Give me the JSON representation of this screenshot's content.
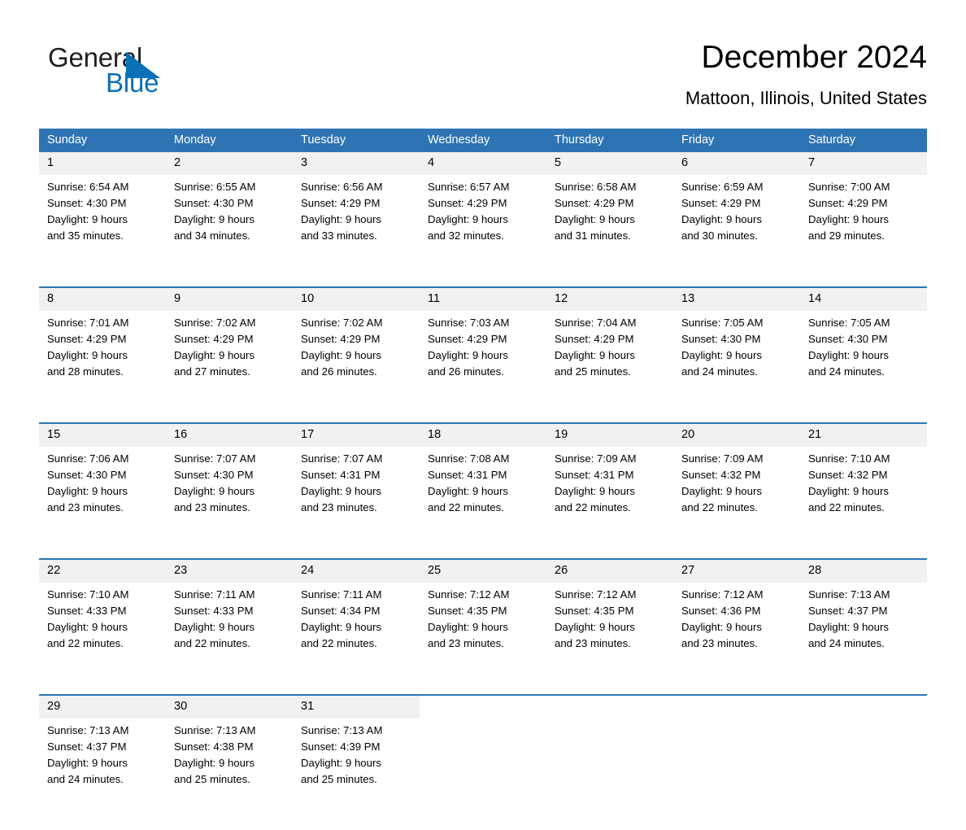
{
  "brand": {
    "word_one": "General",
    "word_two": "Blue",
    "triangle_icon": "brand-triangle-icon",
    "accent_color": "#0a70b8"
  },
  "header": {
    "title": "December 2024",
    "subtitle": "Mattoon, Illinois, United States"
  },
  "theme": {
    "header_band": "#2e74b5",
    "daynum_band": "#f1f1f1",
    "row_rule": "#2e74b5",
    "text": "#000000"
  },
  "calendar": {
    "weekday_headers": [
      "Sunday",
      "Monday",
      "Tuesday",
      "Wednesday",
      "Thursday",
      "Friday",
      "Saturday"
    ],
    "weeks": [
      [
        {
          "day": "1",
          "sunrise": "Sunrise: 6:54 AM",
          "sunset": "Sunset: 4:30 PM",
          "daylight_1": "Daylight: 9 hours",
          "daylight_2": "and 35 minutes."
        },
        {
          "day": "2",
          "sunrise": "Sunrise: 6:55 AM",
          "sunset": "Sunset: 4:30 PM",
          "daylight_1": "Daylight: 9 hours",
          "daylight_2": "and 34 minutes."
        },
        {
          "day": "3",
          "sunrise": "Sunrise: 6:56 AM",
          "sunset": "Sunset: 4:29 PM",
          "daylight_1": "Daylight: 9 hours",
          "daylight_2": "and 33 minutes."
        },
        {
          "day": "4",
          "sunrise": "Sunrise: 6:57 AM",
          "sunset": "Sunset: 4:29 PM",
          "daylight_1": "Daylight: 9 hours",
          "daylight_2": "and 32 minutes."
        },
        {
          "day": "5",
          "sunrise": "Sunrise: 6:58 AM",
          "sunset": "Sunset: 4:29 PM",
          "daylight_1": "Daylight: 9 hours",
          "daylight_2": "and 31 minutes."
        },
        {
          "day": "6",
          "sunrise": "Sunrise: 6:59 AM",
          "sunset": "Sunset: 4:29 PM",
          "daylight_1": "Daylight: 9 hours",
          "daylight_2": "and 30 minutes."
        },
        {
          "day": "7",
          "sunrise": "Sunrise: 7:00 AM",
          "sunset": "Sunset: 4:29 PM",
          "daylight_1": "Daylight: 9 hours",
          "daylight_2": "and 29 minutes."
        }
      ],
      [
        {
          "day": "8",
          "sunrise": "Sunrise: 7:01 AM",
          "sunset": "Sunset: 4:29 PM",
          "daylight_1": "Daylight: 9 hours",
          "daylight_2": "and 28 minutes."
        },
        {
          "day": "9",
          "sunrise": "Sunrise: 7:02 AM",
          "sunset": "Sunset: 4:29 PM",
          "daylight_1": "Daylight: 9 hours",
          "daylight_2": "and 27 minutes."
        },
        {
          "day": "10",
          "sunrise": "Sunrise: 7:02 AM",
          "sunset": "Sunset: 4:29 PM",
          "daylight_1": "Daylight: 9 hours",
          "daylight_2": "and 26 minutes."
        },
        {
          "day": "11",
          "sunrise": "Sunrise: 7:03 AM",
          "sunset": "Sunset: 4:29 PM",
          "daylight_1": "Daylight: 9 hours",
          "daylight_2": "and 26 minutes."
        },
        {
          "day": "12",
          "sunrise": "Sunrise: 7:04 AM",
          "sunset": "Sunset: 4:29 PM",
          "daylight_1": "Daylight: 9 hours",
          "daylight_2": "and 25 minutes."
        },
        {
          "day": "13",
          "sunrise": "Sunrise: 7:05 AM",
          "sunset": "Sunset: 4:30 PM",
          "daylight_1": "Daylight: 9 hours",
          "daylight_2": "and 24 minutes."
        },
        {
          "day": "14",
          "sunrise": "Sunrise: 7:05 AM",
          "sunset": "Sunset: 4:30 PM",
          "daylight_1": "Daylight: 9 hours",
          "daylight_2": "and 24 minutes."
        }
      ],
      [
        {
          "day": "15",
          "sunrise": "Sunrise: 7:06 AM",
          "sunset": "Sunset: 4:30 PM",
          "daylight_1": "Daylight: 9 hours",
          "daylight_2": "and 23 minutes."
        },
        {
          "day": "16",
          "sunrise": "Sunrise: 7:07 AM",
          "sunset": "Sunset: 4:30 PM",
          "daylight_1": "Daylight: 9 hours",
          "daylight_2": "and 23 minutes."
        },
        {
          "day": "17",
          "sunrise": "Sunrise: 7:07 AM",
          "sunset": "Sunset: 4:31 PM",
          "daylight_1": "Daylight: 9 hours",
          "daylight_2": "and 23 minutes."
        },
        {
          "day": "18",
          "sunrise": "Sunrise: 7:08 AM",
          "sunset": "Sunset: 4:31 PM",
          "daylight_1": "Daylight: 9 hours",
          "daylight_2": "and 22 minutes."
        },
        {
          "day": "19",
          "sunrise": "Sunrise: 7:09 AM",
          "sunset": "Sunset: 4:31 PM",
          "daylight_1": "Daylight: 9 hours",
          "daylight_2": "and 22 minutes."
        },
        {
          "day": "20",
          "sunrise": "Sunrise: 7:09 AM",
          "sunset": "Sunset: 4:32 PM",
          "daylight_1": "Daylight: 9 hours",
          "daylight_2": "and 22 minutes."
        },
        {
          "day": "21",
          "sunrise": "Sunrise: 7:10 AM",
          "sunset": "Sunset: 4:32 PM",
          "daylight_1": "Daylight: 9 hours",
          "daylight_2": "and 22 minutes."
        }
      ],
      [
        {
          "day": "22",
          "sunrise": "Sunrise: 7:10 AM",
          "sunset": "Sunset: 4:33 PM",
          "daylight_1": "Daylight: 9 hours",
          "daylight_2": "and 22 minutes."
        },
        {
          "day": "23",
          "sunrise": "Sunrise: 7:11 AM",
          "sunset": "Sunset: 4:33 PM",
          "daylight_1": "Daylight: 9 hours",
          "daylight_2": "and 22 minutes."
        },
        {
          "day": "24",
          "sunrise": "Sunrise: 7:11 AM",
          "sunset": "Sunset: 4:34 PM",
          "daylight_1": "Daylight: 9 hours",
          "daylight_2": "and 22 minutes."
        },
        {
          "day": "25",
          "sunrise": "Sunrise: 7:12 AM",
          "sunset": "Sunset: 4:35 PM",
          "daylight_1": "Daylight: 9 hours",
          "daylight_2": "and 23 minutes."
        },
        {
          "day": "26",
          "sunrise": "Sunrise: 7:12 AM",
          "sunset": "Sunset: 4:35 PM",
          "daylight_1": "Daylight: 9 hours",
          "daylight_2": "and 23 minutes."
        },
        {
          "day": "27",
          "sunrise": "Sunrise: 7:12 AM",
          "sunset": "Sunset: 4:36 PM",
          "daylight_1": "Daylight: 9 hours",
          "daylight_2": "and 23 minutes."
        },
        {
          "day": "28",
          "sunrise": "Sunrise: 7:13 AM",
          "sunset": "Sunset: 4:37 PM",
          "daylight_1": "Daylight: 9 hours",
          "daylight_2": "and 24 minutes."
        }
      ],
      [
        {
          "day": "29",
          "sunrise": "Sunrise: 7:13 AM",
          "sunset": "Sunset: 4:37 PM",
          "daylight_1": "Daylight: 9 hours",
          "daylight_2": "and 24 minutes."
        },
        {
          "day": "30",
          "sunrise": "Sunrise: 7:13 AM",
          "sunset": "Sunset: 4:38 PM",
          "daylight_1": "Daylight: 9 hours",
          "daylight_2": "and 25 minutes."
        },
        {
          "day": "31",
          "sunrise": "Sunrise: 7:13 AM",
          "sunset": "Sunset: 4:39 PM",
          "daylight_1": "Daylight: 9 hours",
          "daylight_2": "and 25 minutes."
        },
        {
          "day": "",
          "sunrise": "",
          "sunset": "",
          "daylight_1": "",
          "daylight_2": ""
        },
        {
          "day": "",
          "sunrise": "",
          "sunset": "",
          "daylight_1": "",
          "daylight_2": ""
        },
        {
          "day": "",
          "sunrise": "",
          "sunset": "",
          "daylight_1": "",
          "daylight_2": ""
        },
        {
          "day": "",
          "sunrise": "",
          "sunset": "",
          "daylight_1": "",
          "daylight_2": ""
        }
      ]
    ]
  }
}
